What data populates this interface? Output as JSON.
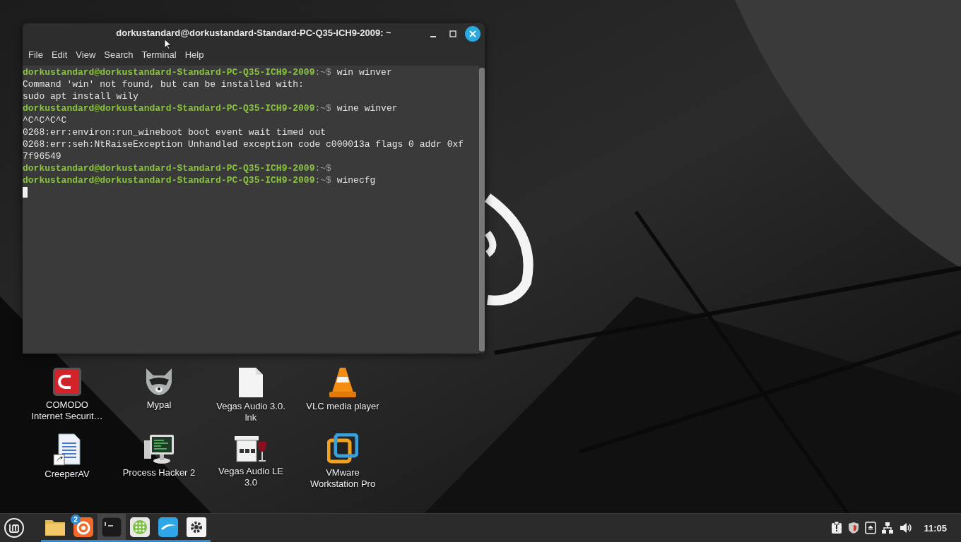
{
  "terminal": {
    "title": "dorkustandard@dorkustandard-Standard-PC-Q35-ICH9-2009: ~",
    "menu": [
      "File",
      "Edit",
      "View",
      "Search",
      "Terminal",
      "Help"
    ],
    "lines": [
      {
        "kind": "prompt",
        "host": "dorkustandard@dorkustandard-Standard-PC-Q35-ICH9-2009",
        "path": ":~$",
        "command": "win winver"
      },
      {
        "kind": "output",
        "text": "Command 'win' not found, but can be installed with:"
      },
      {
        "kind": "output",
        "text": "sudo apt install wily"
      },
      {
        "kind": "prompt",
        "host": "dorkustandard@dorkustandard-Standard-PC-Q35-ICH9-2009",
        "path": ":~$",
        "command": "wine winver"
      },
      {
        "kind": "output",
        "text": "^C^C^C^C"
      },
      {
        "kind": "output",
        "text": "0268:err:environ:run_wineboot boot event wait timed out"
      },
      {
        "kind": "output",
        "text": "0268:err:seh:NtRaiseException Unhandled exception code c000013a flags 0 addr 0xf"
      },
      {
        "kind": "output",
        "text": "7f96549"
      },
      {
        "kind": "prompt",
        "host": "dorkustandard@dorkustandard-Standard-PC-Q35-ICH9-2009",
        "path": ":~$"
      },
      {
        "kind": "prompt",
        "host": "dorkustandard@dorkustandard-Standard-PC-Q35-ICH9-2009",
        "path": ":~$",
        "command": "winecfg"
      },
      {
        "kind": "cursor"
      }
    ]
  },
  "desktop_icons": [
    {
      "kind": "shield",
      "label": "COMODO\nInternet Securit…"
    },
    {
      "kind": "raccoon",
      "label": "Mypal"
    },
    {
      "kind": "file",
      "label": "Vegas Audio 3.0.\nlnk"
    },
    {
      "kind": "cone",
      "label": "VLC media player"
    },
    {
      "kind": "document",
      "label": "CreeperAV"
    },
    {
      "kind": "monitor",
      "label": "Process Hacker 2"
    },
    {
      "kind": "mixer",
      "label": "Vegas Audio LE\n3.0"
    },
    {
      "kind": "vm",
      "label": "VMware\nWorkstation Pro"
    }
  ],
  "taskbar": {
    "apps": [
      {
        "kind": "folder",
        "selected": false
      },
      {
        "kind": "browser",
        "selected": false,
        "badge": "2"
      },
      {
        "kind": "terminal",
        "selected": true
      },
      {
        "kind": "grid",
        "selected": false
      },
      {
        "kind": "dolphin",
        "selected": false
      },
      {
        "kind": "gear",
        "selected": false
      }
    ],
    "clock": "11:05"
  }
}
